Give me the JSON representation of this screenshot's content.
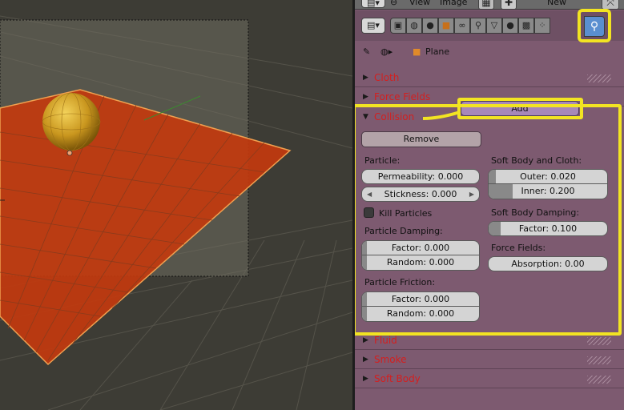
{
  "header": {
    "menu_view": "View",
    "menu_image": "Image",
    "new_label": "New"
  },
  "tabs": {
    "icons": [
      "render-icon",
      "scene-icon",
      "world-icon",
      "object-icon",
      "constraints-icon",
      "modifiers-icon",
      "data-icon",
      "material-icon",
      "texture-icon",
      "particles-icon",
      "physics-icon"
    ],
    "active": "physics-icon"
  },
  "context": {
    "object_name": "Plane"
  },
  "sections": {
    "cloth": "Cloth",
    "force_fields": "Force Fields",
    "collision": "Collision",
    "fluid": "Fluid",
    "smoke": "Smoke",
    "soft_body": "Soft Body"
  },
  "collision": {
    "add_label": "Add",
    "remove_label": "Remove",
    "particle_heading": "Particle:",
    "permeability": "Permeability: 0.000",
    "stickness": "Stickness: 0.000",
    "kill_particles": "Kill Particles",
    "kill_particles_checked": false,
    "particle_damping_heading": "Particle Damping:",
    "pd_factor": "Factor: 0.000",
    "pd_random": "Random: 0.000",
    "particle_friction_heading": "Particle Friction:",
    "pf_factor": "Factor: 0.000",
    "pf_random": "Random: 0.000",
    "softbody_cloth_heading": "Soft Body and Cloth:",
    "outer": "Outer: 0.020",
    "outer_value": 0.02,
    "inner": "Inner: 0.200",
    "inner_value": 0.2,
    "softbody_damping_heading": "Soft Body Damping:",
    "sb_factor": "Factor: 0.100",
    "sb_factor_value": 0.1,
    "force_fields_heading": "Force Fields:",
    "absorption": "Absorption: 0.00"
  },
  "colors": {
    "panel_bg": "#7d5a70",
    "section_label": "#d41f1f",
    "highlight": "#f2e422",
    "active_tab": "#5a8fd0",
    "plane": "#c23a0e",
    "sphere": "#d4a02a"
  }
}
